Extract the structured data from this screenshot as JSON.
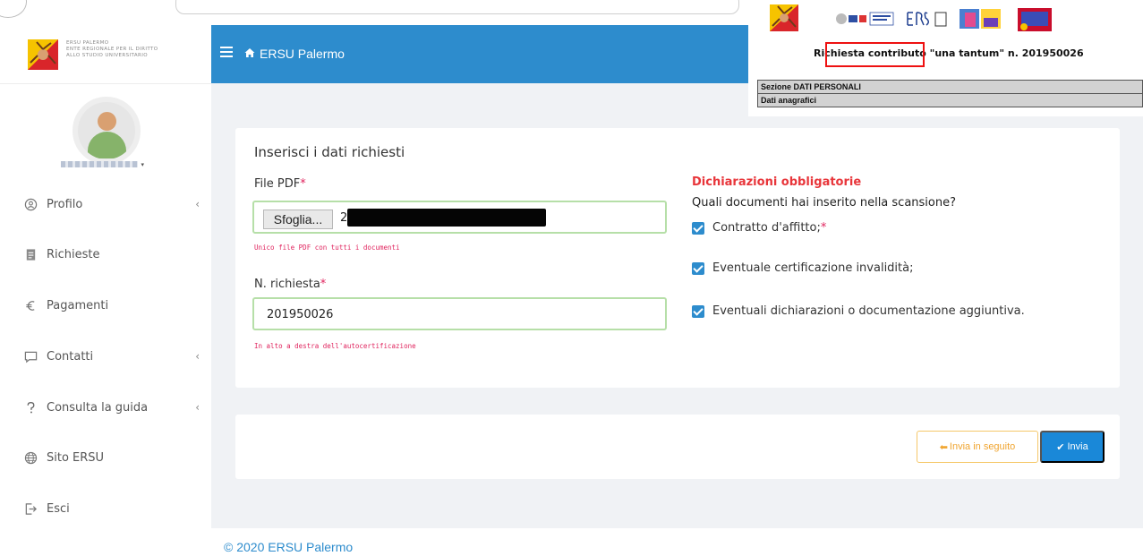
{
  "brand": {
    "name_line1": "ERSU Palermo",
    "name_line2": "Ente Regionale per il Diritto",
    "name_line3": "allo Studio Universitario"
  },
  "header": {
    "title": "ERSU Palermo",
    "menu_icon": "hamburger-icon",
    "home_icon": "home-icon"
  },
  "sidebar": {
    "items": [
      {
        "label": "Profilo",
        "icon": "profile-icon",
        "has_chevron": true
      },
      {
        "label": "Richieste",
        "icon": "document-icon",
        "has_chevron": false
      },
      {
        "label": "Pagamenti",
        "icon": "euro-icon",
        "has_chevron": false
      },
      {
        "label": "Contatti",
        "icon": "chat-icon",
        "has_chevron": true
      },
      {
        "label": "Consulta la guida",
        "icon": "question-icon",
        "has_chevron": true
      },
      {
        "label": "Sito ERSU",
        "icon": "globe-icon",
        "has_chevron": false
      },
      {
        "label": "Esci",
        "icon": "logout-icon",
        "has_chevron": false
      }
    ]
  },
  "form": {
    "title": "Inserisci i dati richiesti",
    "file_label": "File PDF",
    "required_mark": "*",
    "browse_label": "Sfoglia...",
    "file_value_prefix": "2",
    "file_hint": "Unico file PDF con tutti i documenti",
    "request_label": "N. richiesta",
    "request_value": "201950026",
    "request_hint": "In alto a destra dell'autocertificazione"
  },
  "declarations": {
    "title": "Dichiarazioni obbligatorie",
    "question": "Quali documenti hai inserito nella scansione?",
    "items": [
      {
        "label": "Contratto d'affitto;",
        "required": true,
        "checked": true
      },
      {
        "label": "Eventuale certificazione invalidità;",
        "required": false,
        "checked": true
      },
      {
        "label": "Eventuali dichiarazioni o documentazione aggiuntiva.",
        "required": false,
        "checked": true
      }
    ]
  },
  "actions": {
    "later_label": "Invia in seguito",
    "send_label": "Invia"
  },
  "footer": {
    "text": "© 2020 ERSU Palermo"
  },
  "document": {
    "title": "Richiesta contributo \"una tantum\" n. 201950026",
    "title_main": "Richiesta contributo \"una tantum",
    "title_number": "\" n. 201950026",
    "section_row": "Sezione DATI PERSONALI",
    "subsection_row": "Dati anagrafici"
  },
  "colors": {
    "header_blue": "#2d8ccd",
    "required_pink": "#e0245e",
    "declaration_red": "#e8353a",
    "valid_green": "#b6dfa8",
    "warning_orange": "#f0a530"
  }
}
